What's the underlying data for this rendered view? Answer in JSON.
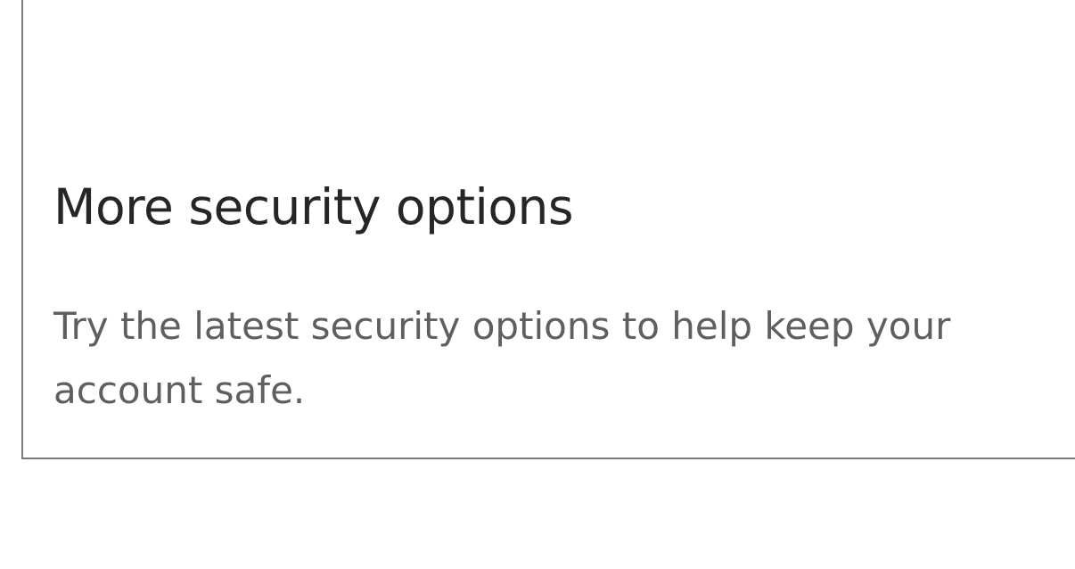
{
  "security_card": {
    "title": "More security options",
    "description": "Try the latest security options to help keep your account safe."
  },
  "colors": {
    "card_border": "#7a7a7a",
    "title_text": "#262626",
    "description_text": "#5f5f5f",
    "background": "#ffffff"
  }
}
